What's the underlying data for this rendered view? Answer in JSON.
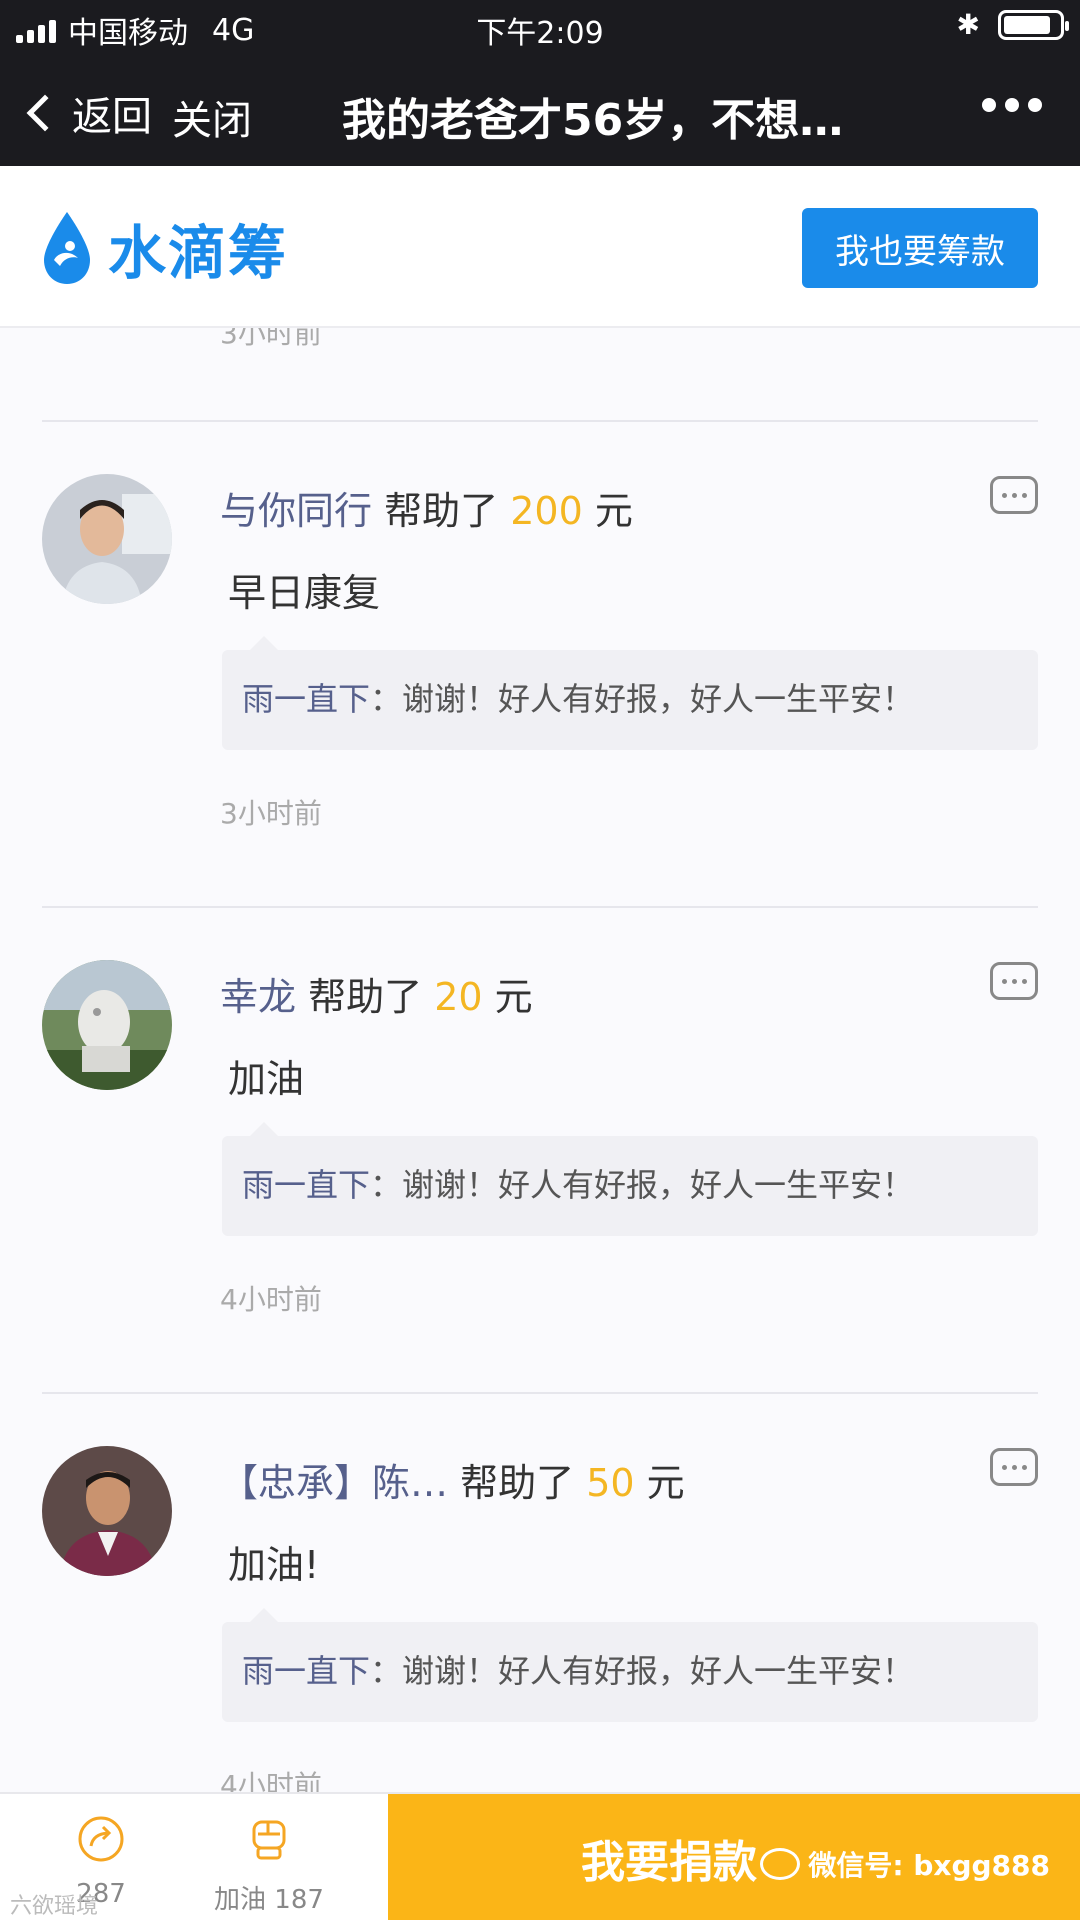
{
  "status_bar": {
    "carrier": "中国移动",
    "network": "4G",
    "time": "下午2:09",
    "battery_level": 0.85
  },
  "nav": {
    "back_label": "返回",
    "close_label": "关闭",
    "title": "我的老爸才56岁，不想…"
  },
  "header": {
    "brand": "水滴筹",
    "cta": "我也要筹款",
    "brand_color": "#1a8bea"
  },
  "feed": {
    "partial_time": "3小时前",
    "entries": [
      {
        "name": "与你同行",
        "action": "帮助了",
        "amount": "200",
        "unit": "元",
        "message": "早日康复",
        "reply_who": "雨一直下",
        "reply_sep": "：",
        "reply_msg": "谢谢！好人有好报，好人一生平安！",
        "time": "3小时前"
      },
      {
        "name": "幸龙",
        "action": "帮助了",
        "amount": "20",
        "unit": "元",
        "message": "加油",
        "reply_who": "雨一直下",
        "reply_sep": "：",
        "reply_msg": "谢谢！好人有好报，好人一生平安！",
        "time": "4小时前"
      },
      {
        "name": "【忠承】陈…",
        "action": "帮助了",
        "amount": "50",
        "unit": "元",
        "message": "加油!",
        "reply_who": "雨一直下",
        "reply_sep": "：",
        "reply_msg": "谢谢！好人有好报，好人一生平安！",
        "time": "4小时前"
      }
    ]
  },
  "bottom": {
    "share_count": "287",
    "cheer_label": "加油 187",
    "donate_label": "我要捐款",
    "watermark": "微信号: bxgg888",
    "watermark_left": "六欲瑶境",
    "accent_color": "#fbb517"
  }
}
